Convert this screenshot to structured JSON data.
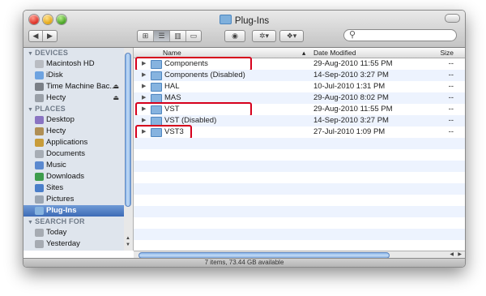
{
  "window": {
    "title": "Plug-Ins"
  },
  "toolbar": {
    "back_icon": "back-arrow-icon",
    "forward_icon": "forward-arrow-icon",
    "view_modes": [
      "icon-view",
      "list-view",
      "column-view",
      "cover-flow-view"
    ],
    "selected_view": "list-view",
    "quicklook_icon": "eye-icon",
    "action_icon": "gear-icon",
    "dropbox_icon": "dropbox-icon"
  },
  "sidebar": {
    "sections": [
      {
        "title": "DEVICES",
        "items": [
          {
            "label": "Macintosh HD",
            "icon": "hard-disk-icon",
            "eject": false
          },
          {
            "label": "iDisk",
            "icon": "idisk-icon",
            "eject": false
          },
          {
            "label": "Time Machine Bac...",
            "icon": "external-disk-icon",
            "eject": true
          },
          {
            "label": "Hecty",
            "icon": "disk-icon",
            "eject": true
          }
        ]
      },
      {
        "title": "PLACES",
        "items": [
          {
            "label": "Desktop",
            "icon": "desktop-icon"
          },
          {
            "label": "Hecty",
            "icon": "home-icon"
          },
          {
            "label": "Applications",
            "icon": "applications-icon"
          },
          {
            "label": "Documents",
            "icon": "documents-icon"
          },
          {
            "label": "Music",
            "icon": "music-icon"
          },
          {
            "label": "Downloads",
            "icon": "downloads-icon"
          },
          {
            "label": "Sites",
            "icon": "sites-icon"
          },
          {
            "label": "Pictures",
            "icon": "pictures-icon"
          },
          {
            "label": "Plug-Ins",
            "icon": "folder-icon",
            "selected": true
          }
        ]
      },
      {
        "title": "SEARCH FOR",
        "items": [
          {
            "label": "Today",
            "icon": "clock-icon"
          },
          {
            "label": "Yesterday",
            "icon": "clock-icon"
          }
        ]
      }
    ]
  },
  "table": {
    "columns": {
      "name": "Name",
      "date": "Date Modified",
      "size": "Size"
    },
    "sort_column": "Name",
    "rows": [
      {
        "name": "Components",
        "date": "29-Aug-2010 11:55 PM",
        "size": "--",
        "highlighted": true
      },
      {
        "name": "Components (Disabled)",
        "date": "14-Sep-2010 3:27 PM",
        "size": "--"
      },
      {
        "name": "HAL",
        "date": "10-Jul-2010 1:31 PM",
        "size": "--"
      },
      {
        "name": "MAS",
        "date": "29-Aug-2010 8:02 PM",
        "size": "--"
      },
      {
        "name": "VST",
        "date": "29-Aug-2010 11:55 PM",
        "size": "--",
        "highlighted": true
      },
      {
        "name": "VST (Disabled)",
        "date": "14-Sep-2010 3:27 PM",
        "size": "--"
      },
      {
        "name": "VST3",
        "date": "27-Jul-2010 1:09 PM",
        "size": "--",
        "highlighted": true
      }
    ]
  },
  "status": {
    "text": "7 items, 73.44 GB available"
  },
  "colors": {
    "highlight_box": "#d6001c",
    "selection": "#3d6bb6",
    "sidebar_bg": "#dfe5ed"
  }
}
